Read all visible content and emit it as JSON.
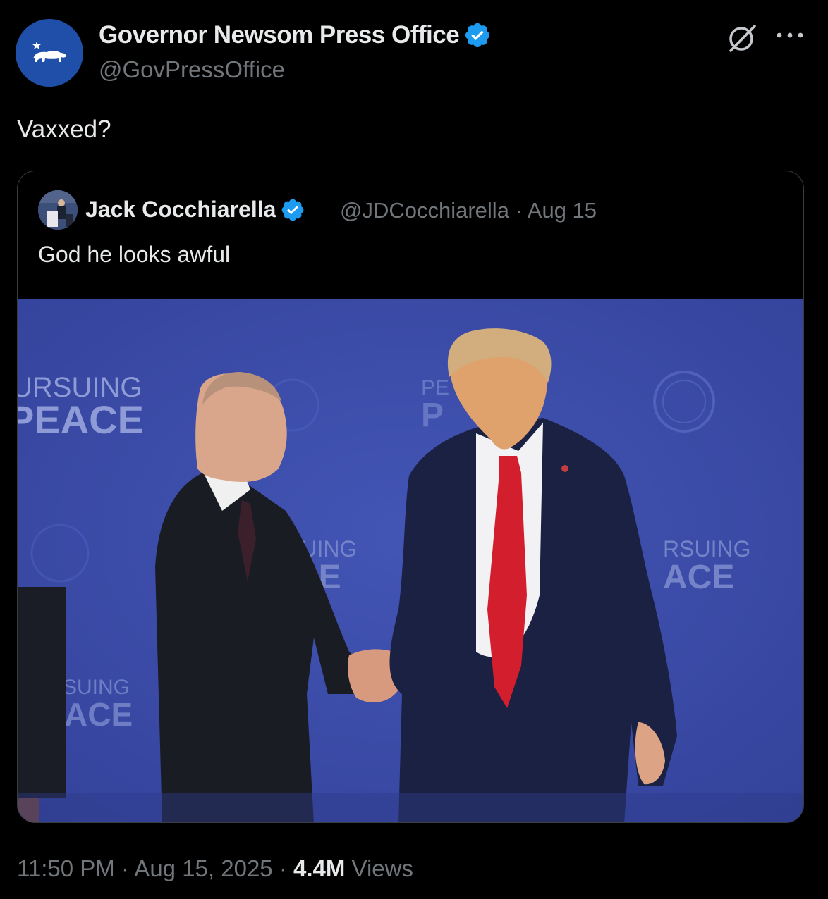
{
  "author": {
    "name": "Governor Newsom Press Office",
    "handle": "@GovPressOffice",
    "avatar_icon": "california-bear-icon",
    "verified_color": "#1d9bf0"
  },
  "tweet": {
    "text": "Vaxxed?"
  },
  "quoted": {
    "name": "Jack Cocchiarella",
    "handle_date": "@JDCocchiarella · Aug 15",
    "text": "God he looks awful",
    "media_backdrop": {
      "left": "URSUING",
      "left_big": "PEACE",
      "center": "SUING",
      "center_big": "CE",
      "right": "RSUING",
      "right_big": "ACE",
      "lower_left": "SUING",
      "lower_left_big": "ACE",
      "top_center": "PE",
      "top_center_big": "P"
    }
  },
  "meta": {
    "time": "11:50 PM · Aug 15, 2025 · ",
    "views_count": "4.4M",
    "views_label": " Views"
  },
  "colors": {
    "background": "#000000",
    "text": "#e7e9ea",
    "muted": "#71767b",
    "border": "#3a3d42",
    "backdrop_blue": "#3a4ba8"
  }
}
